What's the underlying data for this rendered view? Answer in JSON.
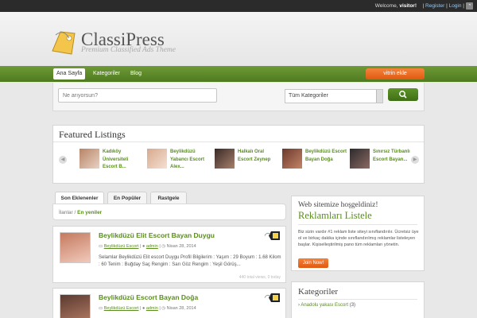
{
  "topbar": {
    "welcome_prefix": "Welcome, ",
    "user": "visitor!",
    "sep": "|",
    "register": "Register",
    "login": "Login",
    "rss_icon": "rss-icon"
  },
  "header": {
    "title": "ClassiPress",
    "subtitle": "Premium Classified Ads Theme",
    "logo_icon": "price-tag-icon"
  },
  "nav": {
    "items": [
      "Ana Sayfa",
      "Kategoriler",
      "Blog"
    ],
    "post_button": "vitrin ekle"
  },
  "search": {
    "placeholder": "Ne arıyorsun?",
    "category": "Tüm Kategoriler",
    "button_icon": "search-icon"
  },
  "featured": {
    "title": "Featured Listings",
    "items": [
      "Kadıköy Üniversiteli Escort B...",
      "Beylikdüzü Yabancı Escort Alex...",
      "Halkalı Oral Escort Zeynep",
      "Beylikdüzü Escort Bayan Doğa",
      "Sınırsız Türbanlı Escort Bayan..."
    ]
  },
  "tabs": [
    "Son Eklenenler",
    "En Popüler",
    "Rastgele"
  ],
  "breadcrumb": {
    "root": "İlanlar",
    "sep": " / ",
    "current": "En yeniler"
  },
  "listings": [
    {
      "title": "Beylikdüzü Elit Escort Bayan Duygu",
      "category": "Beylikdüzü Escort",
      "author": "admin",
      "date": "Nisan 28, 2014",
      "description": "Selamlar Beylikdüzü Elit escort Duygu Profil Bilgilerim : Yaşım : 29 Boyum : 1.68 Kilom : 60 Tenim : Buğday Saç Rengim : Sarı Göz Rengim : Yeşil Görüş...",
      "stats": "440 total views, 0 today"
    },
    {
      "title": "Beylikdüzü Escort Bayan Doğa",
      "category": "Beylikdüzü Escort",
      "author": "admin",
      "date": "Nisan 28, 2014",
      "description": "",
      "stats": ""
    }
  ],
  "sidebar": {
    "welcome_heading": "Web sitemize hoşgeldiniz!",
    "welcome_big": "Reklamları Listele",
    "welcome_text": "Biz sizin vardır #1 reklam liste siteyi sınıflandırılır. Ücretsiz üye ol ve birkaç dakika içinde sınıflandırılmış reklamlar listeleyen başlar. Kişiselleştirilmiş pano tüm reklamları yönetin.",
    "join_button": "Join Now!",
    "categories_heading": "Kategoriler",
    "categories": [
      {
        "name": "Anadolu yakası Escort",
        "count": "(3)"
      }
    ]
  },
  "colors": {
    "brand_green": "#5a8d1f",
    "nav_green": "#5f8a2a",
    "accent_orange": "#f07030"
  }
}
